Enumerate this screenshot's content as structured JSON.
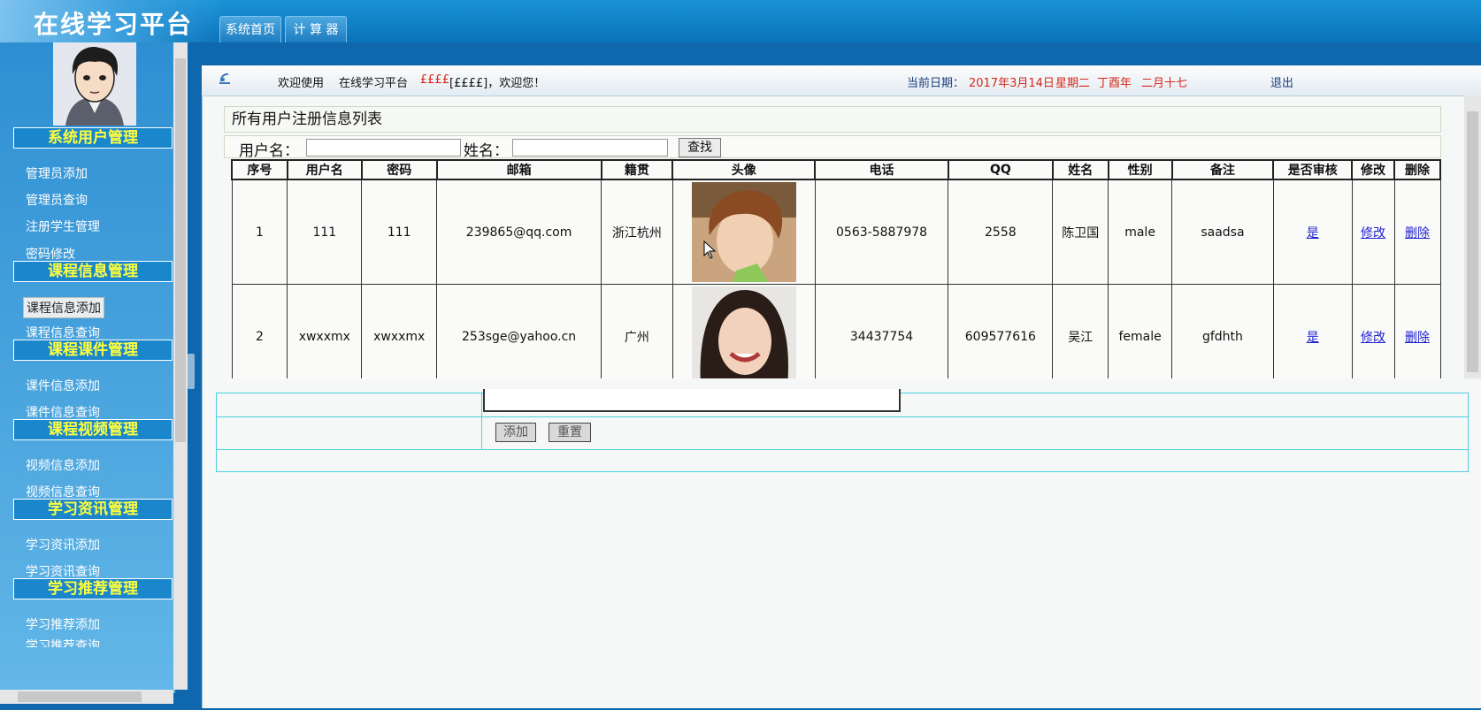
{
  "app": {
    "title": "在线学习平台"
  },
  "tabs": [
    {
      "label": "系统首页"
    },
    {
      "label": "计 算 器"
    }
  ],
  "sidebar": {
    "sections": [
      {
        "title": "系统用户管理",
        "items": [
          "管理员添加",
          "管理员查询",
          "注册学生管理",
          "密码修改"
        ]
      },
      {
        "title": "课程信息管理",
        "items": [
          "课程信息添加",
          "课程信息查询"
        ]
      },
      {
        "title": "课程课件管理",
        "items": [
          "课件信息添加",
          "课件信息查询"
        ]
      },
      {
        "title": "课程视频管理",
        "items": [
          "视频信息添加",
          "视频信息查询"
        ]
      },
      {
        "title": "学习资讯管理",
        "items": [
          "学习资讯添加",
          "学习资讯查询"
        ]
      },
      {
        "title": "学习推荐管理",
        "items": [
          "学习推荐添加",
          "学习推荐查询"
        ]
      }
    ]
  },
  "welcome": {
    "greeting": "欢迎使用",
    "platform": "在线学习平台",
    "user": "££££",
    "user_bracket": "[££££]，欢迎您！",
    "date_label": "当前日期：",
    "date_value": "2017年3月14日",
    "weekday": "星期二",
    "lunar_year": "丁酉年",
    "lunar_day": "二月十七",
    "logout": "退出"
  },
  "list": {
    "title": "所有用户注册信息列表",
    "search": {
      "username_label": "用户名：",
      "name_label": "姓名：",
      "button": "查找"
    },
    "columns": [
      "序号",
      "用户名",
      "密码",
      "邮箱",
      "籍贯",
      "头像",
      "电话",
      "QQ",
      "姓名",
      "性别",
      "备注",
      "是否审核",
      "修改",
      "删除"
    ],
    "rows": [
      {
        "id": "1",
        "username": "111",
        "password": "111",
        "email": "239865@qq.com",
        "hometown": "浙江杭州",
        "phone": "0563-5887978",
        "qq": "2558",
        "name": "陈卫国",
        "gender": "male",
        "note": "saadsa",
        "approved": "是",
        "edit": "修改",
        "delete": "删除"
      },
      {
        "id": "2",
        "username": "xwxxmx",
        "password": "xwxxmx",
        "email": "253sge@yahoo.cn",
        "hometown": "广州",
        "phone": "34437754",
        "qq": "609577616",
        "name": "吴江",
        "gender": "female",
        "note": "gfdhth",
        "approved": "是",
        "edit": "修改",
        "delete": "删除"
      }
    ]
  },
  "form": {
    "add_button": "添加",
    "reset_button": "重置"
  }
}
